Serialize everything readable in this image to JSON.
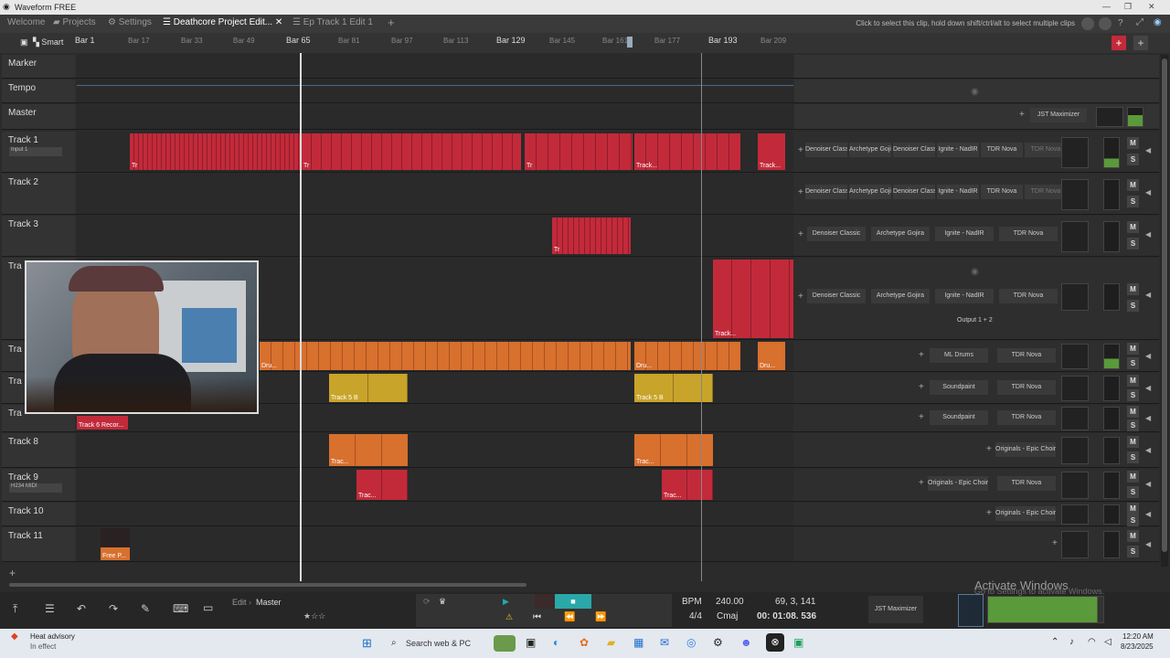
{
  "window": {
    "title": "Waveform FREE"
  },
  "tabs": [
    {
      "label": "Welcome"
    },
    {
      "label": "Projects"
    },
    {
      "label": "Settings"
    },
    {
      "label": "Deathcore Project Edit..."
    },
    {
      "label": "Ep Track 1 Edit 1"
    }
  ],
  "hint": "Click to select this clip, hold down shift/ctrl/alt to select multiple clips",
  "toolbar": {
    "smart": "Smart"
  },
  "ruler": {
    "major": [
      "Bar 1",
      "Bar 65",
      "Bar 129",
      "Bar 193"
    ],
    "minor": [
      "Bar 17",
      "Bar 33",
      "Bar 49",
      "Bar 81",
      "Bar 97",
      "Bar 113",
      "Bar 145",
      "Bar 161",
      "Bar 177",
      "Bar 209"
    ]
  },
  "lanes": {
    "marker": "Marker",
    "tempo": "Tempo",
    "master": "Master",
    "master_plugin": "JST Maximizer",
    "track1": "Track 1",
    "track1_input": "Input 1",
    "track2": "Track 2",
    "track3": "Track 3",
    "track4": "Tra",
    "track5": "Tra",
    "track6": "Tra",
    "track7": "Tra",
    "track8": "Track 8",
    "track9": "Track 9",
    "track9_input": "H234 MIDI",
    "track10": "Track 10",
    "track11": "Track 11",
    "output_label": "Output 1 + 2"
  },
  "plugins": {
    "denoiser": "Denoiser Classic",
    "archetype": "Archetype Gojira",
    "ignite": "Ignite - NadIR",
    "tdr": "TDR Nova",
    "ml_drums": "ML Drums",
    "soundpaint": "Soundpaint",
    "originals": "Originals - Epic Choir"
  },
  "clips": {
    "track6_rec": "Track 6 Recor...",
    "track5_a": "Track 5 B",
    "track5_b": "Track 5 B",
    "free": "Free P...",
    "trac": "Trac...",
    "track": "Track...",
    "dru": "Dru...",
    "tr": "Tr"
  },
  "edit": {
    "crumb1": "Edit",
    "crumb2": "Master"
  },
  "transport": {
    "bpm_label": "BPM",
    "bpm": "240.00",
    "sig": "4/4",
    "key": "Cmaj",
    "position": "69, 3, 141",
    "time": "00: 01:08. 536",
    "plugin_chip": "JST Maximizer"
  },
  "watermark": {
    "title": "Activate Windows",
    "sub": "Go to Settings to activate Windows."
  },
  "taskbar": {
    "weather_title": "Heat advisory",
    "weather_sub": "In effect",
    "search": "Search web & PC",
    "time": "12:20 AM",
    "date": "8/23/2025"
  },
  "colors": {
    "red": "#c22a3a",
    "orange": "#d8702e",
    "gold": "#c9a42a",
    "accent": "#e0e0e0"
  }
}
